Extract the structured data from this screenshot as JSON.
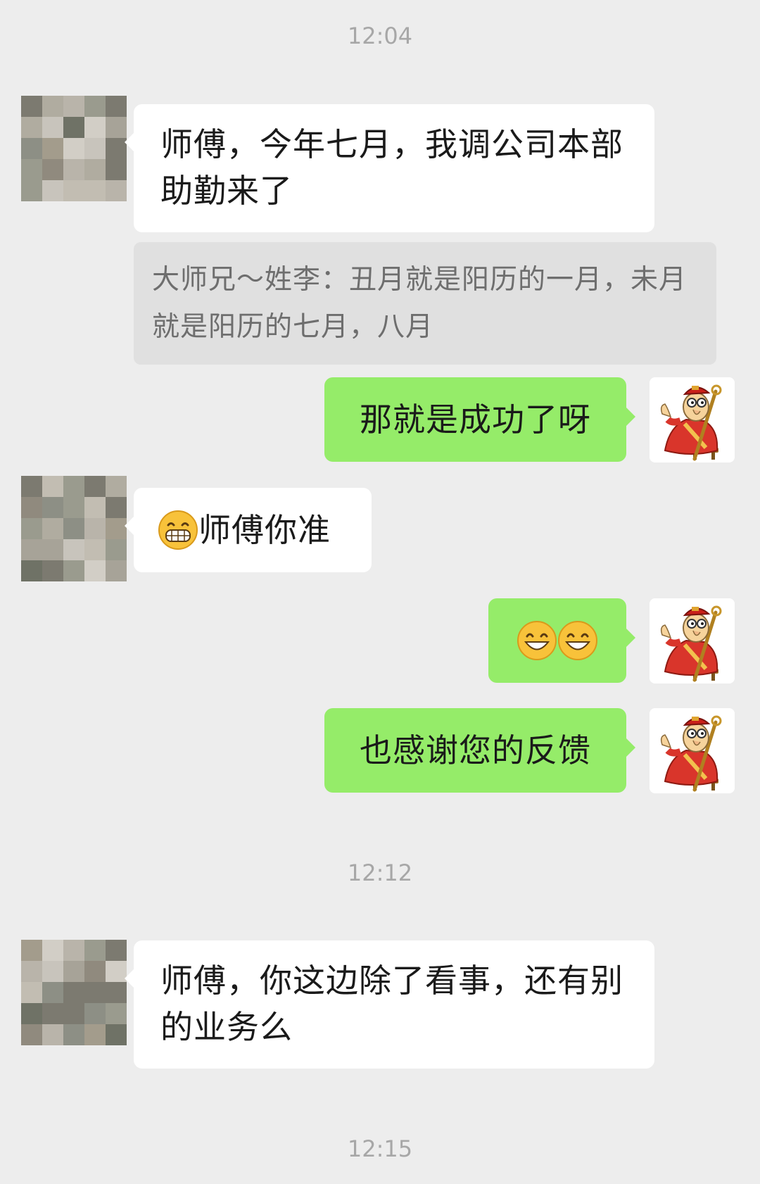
{
  "chat": {
    "timestamps": [
      "12:04",
      "12:12",
      "12:15"
    ],
    "messages": [
      {
        "side": "in",
        "text": "师傅，今年七月，我调公司本部助勤来了"
      },
      {
        "side": "quote",
        "text": "大师兄～姓李：丑月就是阳历的一月，未月就是阳历的七月，八月"
      },
      {
        "side": "out",
        "text": "那就是成功了呀"
      },
      {
        "side": "in",
        "emoji": "grin-face-icon",
        "text": "师傅你准"
      },
      {
        "side": "out",
        "emoji": [
          "smile-face-icon",
          "smile-face-icon"
        ]
      },
      {
        "side": "out",
        "text": "也感谢您的反馈"
      },
      {
        "side": "in",
        "text": "师傅，你这边除了看事，还有别的业务么"
      }
    ]
  },
  "colors": {
    "background": "#ededed",
    "incoming_bubble": "#ffffff",
    "outgoing_bubble": "#95ec69",
    "quote_bubble": "#e0e0e0",
    "timestamp_text": "#a7a7a7"
  },
  "avatars": {
    "contact": "pixelated-contact-avatar",
    "self": "monk-cartoon-avatar-icon"
  }
}
